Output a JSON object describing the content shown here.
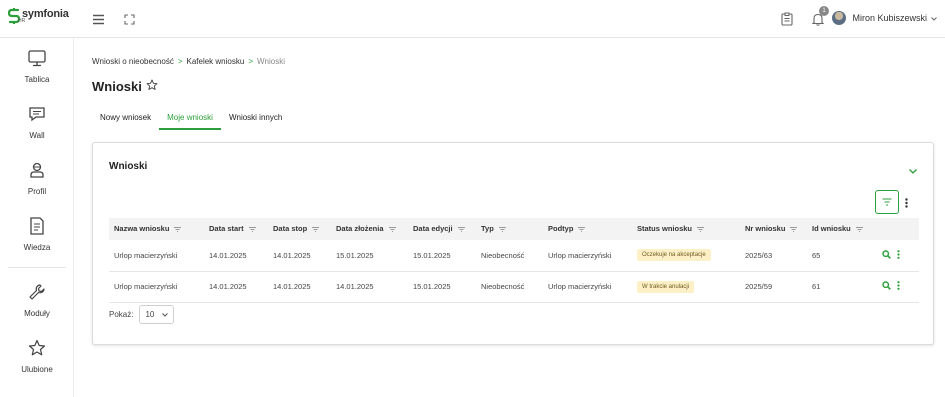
{
  "app": {
    "logo_text": "symfonia",
    "logo_sub": "HR",
    "user_name": "Miron Kubiszewski",
    "notification_count": "1",
    "brand_color": "#2c9f3a"
  },
  "sidebar": {
    "items": [
      {
        "label": "Tablica",
        "icon": "monitor-icon"
      },
      {
        "label": "Wall",
        "icon": "chat-icon"
      },
      {
        "label": "Profil",
        "icon": "profile-icon"
      },
      {
        "label": "Wiedza",
        "icon": "document-icon"
      },
      {
        "label": "Moduły",
        "icon": "wrench-icon"
      },
      {
        "label": "Ulubione",
        "icon": "star-icon"
      }
    ]
  },
  "breadcrumb": {
    "items": [
      "Wnioski o nieobecność",
      "Kafelek wniosku",
      "Wnioski"
    ],
    "separator": ">"
  },
  "page": {
    "title": "Wnioski"
  },
  "tabs": [
    {
      "label": "Nowy wniosek",
      "active": false
    },
    {
      "label": "Moje wnioski",
      "active": true
    },
    {
      "label": "Wnioski innych",
      "active": false
    }
  ],
  "card": {
    "title": "Wnioski",
    "columns": [
      "Nazwa wniosku",
      "Data start",
      "Data stop",
      "Data złożenia",
      "Data edycji",
      "Typ",
      "Podtyp",
      "Status wniosku",
      "Nr wniosku",
      "Id wniosku"
    ],
    "rows": [
      {
        "name": "Urlop macierzyński",
        "start": "14.01.2025",
        "stop": "14.01.2025",
        "submitted": "15.01.2025",
        "edited": "15.01.2025",
        "type": "Nieobecność",
        "subtype": "Urlop macierzyński",
        "status": "Oczekuje na akceptacje",
        "nr": "2025/63",
        "id": "65"
      },
      {
        "name": "Urlop macierzyński",
        "start": "14.01.2025",
        "stop": "14.01.2025",
        "submitted": "14.01.2025",
        "edited": "15.01.2025",
        "type": "Nieobecność",
        "subtype": "Urlop macierzyński",
        "status": "W trakcie anulacji",
        "nr": "2025/59",
        "id": "61"
      }
    ],
    "pager": {
      "label": "Pokaż:",
      "value": "10"
    }
  }
}
